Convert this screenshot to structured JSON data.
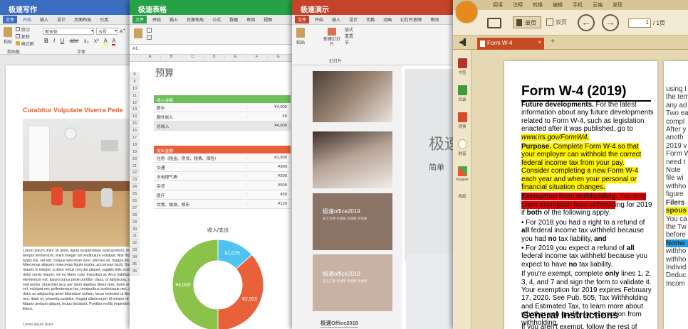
{
  "writer": {
    "title": "极速写作",
    "menus": [
      "文件",
      "开始",
      "插入",
      "设计",
      "页面布局",
      "引用"
    ],
    "font_name": "新宋体",
    "font_size": "五号",
    "ribbon": {
      "paste": "粘贴",
      "cut": "剪切",
      "copy": "复制",
      "format": "格式刷",
      "clipboard": "剪贴板",
      "font": "字体"
    },
    "heading": "Curabitur Vulputate Viverra Pede",
    "body": "Lorem ipsum dolor sit amet, ligula suspendisse nulla pretium, rhoncus tempor fermentum, enim integer ad vestibulum volutpat. Nisl rhoncus turpis est, vel elit, congue wisi enim nunc ultricies sit, magna tincidunt. Maecenas aliquam maecenas ligula nostra, accumsan taciti. Sociis mauris in integer, a dolor netus non dui aliquet, sagittis felis sodales, dolor sociis mauris, vel eu libero cras. Faucibus at. Arcu habitasse elementum est, ipsum purus pede porttitor class, ut adipiscing, aliquet sed auctor, imperdiet arcu per diam dapibus libero duis. Enim eros in vel, volutpat nec pellentesque leo, temporibus scelerisque nec. Ac dolor ac adipiscing amet bibendum nullam, lacus molestie ut libero nec, diam et, pharetra sodales, feugiat ullamcorper id tempor id vitae. Mauris pretium aliquet, lectus tincidunt. Porttitor mollis imperdiet libero.",
    "footer": "Lorem Ipsum Dolor"
  },
  "sheet": {
    "title": "极速表格",
    "menus": [
      "文件",
      "开始",
      "插入",
      "页面布局",
      "公式",
      "数据",
      "审阅",
      "视图"
    ],
    "cell_ref": "A1",
    "cols": [
      "A",
      "B",
      "C",
      "D",
      "E",
      "F",
      "G"
    ],
    "rows": [
      "8",
      "9",
      "10",
      "11",
      "12",
      "13",
      "14",
      "15",
      "16",
      "17",
      "18",
      "19",
      "20",
      "21",
      "22",
      "23",
      "24",
      "25",
      "26",
      "27",
      "28",
      "29",
      "30",
      "31",
      "32",
      "33",
      "34",
      "35",
      "36"
    ],
    "budget_title": "预算",
    "income": {
      "header": "收入金额",
      "rows": [
        [
          "薪水",
          "¥4,000"
        ],
        [
          "额外收入",
          "¥0"
        ]
      ],
      "total": [
        "总收入",
        "¥4,000"
      ]
    },
    "expense": {
      "header": "支出金额",
      "rows": [
        [
          "住房（租金、房贷、税费、保险）",
          "¥1,500"
        ],
        [
          "交通",
          "¥300"
        ],
        [
          "水电煤气费",
          "¥200"
        ],
        [
          "杂货",
          "¥500"
        ],
        [
          "医疗",
          "¥30"
        ],
        [
          "饮食、旅游、娱乐",
          "¥120"
        ]
      ]
    },
    "chart_title": "收入/支出",
    "chart_labels": [
      "¥4,000",
      "¥1,075",
      "¥2,925"
    ],
    "colors": {
      "green": "#27a146",
      "orange": "#e8613a",
      "blue": "#4fc3f0",
      "donut_green": "#8bc34a"
    }
  },
  "chart_data": {
    "type": "pie",
    "title": "收入/支出",
    "values": [
      4000,
      1075,
      2925
    ],
    "labels": [
      "¥4,000",
      "¥1,075",
      "¥2,925"
    ]
  },
  "slides": {
    "title": "极速演示",
    "menus": [
      "文件",
      "开始",
      "插入",
      "设计",
      "切换",
      "动画",
      "幻灯片放映",
      "审阅"
    ],
    "ribbon": {
      "paste": "粘贴",
      "new_slide": "新建幻灯片",
      "layout": "版式",
      "reset": "重置",
      "section": "节",
      "slides_group": "幻灯片"
    },
    "thumb3_title": "极速office2019",
    "thumb3_sub": "安全方便 幸福眼 幸福眼 幸福眼",
    "thumb4_title": "极速office2019",
    "thumb4_sub": "安全方便 幸福眼 幸福眼 幸福眼",
    "bottom_label": "极速Office2018",
    "big_text": "极速",
    "sub_text": "简单"
  },
  "reader": {
    "tabs": [
      "阅读",
      "注释",
      "转换",
      "编辑",
      "手机",
      "云端",
      "发现"
    ],
    "single_page": "单页",
    "double_page": "双页",
    "page_num": "1",
    "page_total": "/ 1页",
    "doc_tab": "Form W-4",
    "sidebar": [
      "书签",
      "目录",
      "转换",
      "财富",
      "Xpaper",
      "收起"
    ],
    "form_title": "Form W-4 (2019)",
    "p1_bold": "Future developments.",
    "p1": " For the latest information about any future developments related to Form W-4, such as legislation enacted after it was published, go to ",
    "p1_link": "www.irs.gov/FormW4.",
    "p2_bold": "Purpose.",
    "p2": " Complete Form W-4 so that your employer can withhold the correct federal income tax from your pay. Consider completing a new Form W-4 each year and when your personal or financial situation changes.",
    "p3_bold": "Exemption from withholding.",
    "p3_hl": " You may claim exemption from withhold",
    "p3": "ing for 2019 if ",
    "p3_b2": "both",
    "p3_end": " of the following apply.",
    "p4": "• For 2018 you had a right to a refund of ",
    "p4_b1": "all",
    "p4_mid": " federal income tax withheld because you had ",
    "p4_b2": "no",
    "p4_end": " tax liability, ",
    "p4_b3": "and",
    "p5": "• For 2019 you expect a refund of ",
    "p5_b1": "all",
    "p5_mid": " federal income tax withheld because you expect to have ",
    "p5_b2": "no",
    "p5_end": " tax liability.",
    "p6": "If you're exempt, complete ",
    "p6_b": "only",
    "p6_end": " lines 1, 2, 3, 4, and 7 and sign the form to validate it. Your exemption for 2019 expires February 17, 2020. See Pub. 505, Tax Withholding and Estimated Tax, to learn more about whether you qualify for exemption from withholding.",
    "gi": "General Instructions",
    "last": "If you aren't exempt, follow the rest of",
    "right_col": [
      "using t",
      "the tem",
      "any ad",
      "Two ea",
      "compl",
      "After y",
      "anoth",
      "2019 v",
      "Form W",
      "need t",
      "Note",
      "file wi",
      "withho",
      "figure",
      "Filers",
      "spous",
      "You ca",
      "the Tw",
      "before",
      "Nonw",
      "withho",
      "withho",
      "Individ",
      "Deduc",
      "Incom"
    ]
  }
}
